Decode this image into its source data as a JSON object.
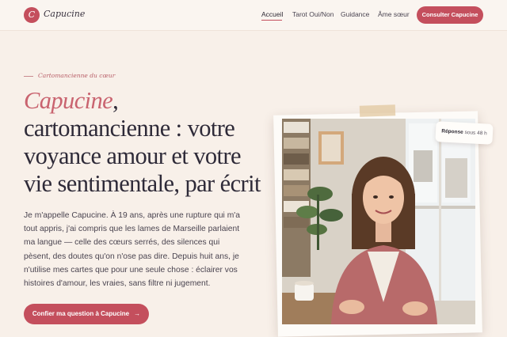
{
  "brand": {
    "initial": "C",
    "name": "Capucine"
  },
  "nav": {
    "items": [
      {
        "label": "Accueil",
        "active": true
      },
      {
        "label": "Tarot Oui/Non",
        "active": false
      },
      {
        "label": "Guidance",
        "active": false
      },
      {
        "label": "Âme sœur",
        "active": false
      }
    ],
    "cta": "Consulter Capucine"
  },
  "hero": {
    "eyebrow": "Cartomancienne du cœur",
    "title_accent": "Capucine",
    "title_rest": ", cartomancienne : votre voyance amour et votre vie sentimentale, par écrit",
    "intro": "Je m'appelle Capucine. À 19 ans, après une rupture qui m'a tout appris, j'ai compris que les lames de Marseille parlaient ma langue — celle des cœurs serrés, des silences qui pèsent, des doutes qu'on n'ose pas dire. Depuis huit ans, je n'utilise mes cartes que pour une seule chose : éclairer vos histoires d'amour, les vraies, sans filtre ni jugement.",
    "cta": "Confier ma question à Capucine",
    "cta_arrow": "→"
  },
  "badge": {
    "strong": "Réponse",
    "rest": " sous 48 h"
  },
  "colors": {
    "accent": "#c44f5d",
    "background": "#f8f0e9",
    "headline": "#2e2a38"
  }
}
